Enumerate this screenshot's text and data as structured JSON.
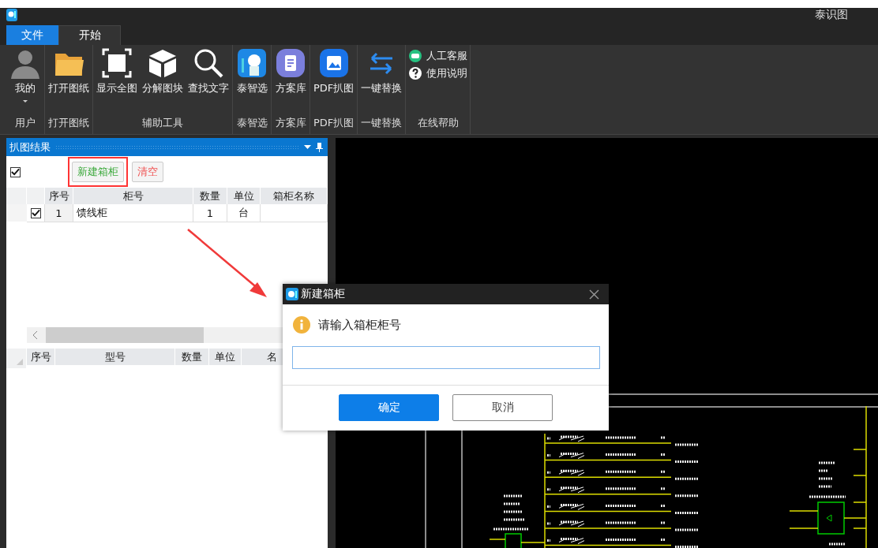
{
  "window": {
    "title": "泰识图"
  },
  "tabs": [
    {
      "label": "文件",
      "kind": "file",
      "selected": false
    },
    {
      "label": "开始",
      "kind": "tab",
      "selected": true
    }
  ],
  "ribbon": {
    "groups": [
      {
        "label": "用户",
        "buttons": [
          {
            "label": "我的",
            "kind": "large",
            "dropdown": true
          }
        ]
      },
      {
        "label": "打开图纸",
        "buttons": [
          {
            "label": "打开图纸",
            "kind": "large",
            "dropdown": false
          }
        ]
      },
      {
        "label": "辅助工具",
        "buttons": [
          {
            "label": "显示全图",
            "kind": "large",
            "dropdown": false
          },
          {
            "label": "分解图块",
            "kind": "large",
            "dropdown": false
          },
          {
            "label": "查找文字",
            "kind": "large",
            "dropdown": false
          }
        ]
      },
      {
        "label": "泰智选",
        "buttons": [
          {
            "label": "泰智选",
            "kind": "large",
            "dropdown": false
          }
        ]
      },
      {
        "label": "方案库",
        "buttons": [
          {
            "label": "方案库",
            "kind": "large",
            "dropdown": false
          }
        ]
      },
      {
        "label": "PDF扒图",
        "buttons": [
          {
            "label": "PDF扒图",
            "kind": "large",
            "dropdown": false
          }
        ]
      },
      {
        "label": "一键替换",
        "buttons": [
          {
            "label": "一键替换",
            "kind": "large",
            "dropdown": false
          }
        ]
      },
      {
        "label": "在线帮助",
        "buttons": [
          {
            "label": "人工客服",
            "kind": "small",
            "dropdown": false
          },
          {
            "label": "使用说明",
            "kind": "small",
            "dropdown": false
          }
        ]
      }
    ]
  },
  "panel": {
    "title": "扒图结果",
    "select_all": {
      "checked": true
    },
    "buttons": [
      {
        "label": "新建箱柜",
        "kind": "new",
        "highlighted": true
      },
      {
        "label": "清空",
        "kind": "clear",
        "highlighted": false
      }
    ],
    "cabinet_table": {
      "columns": [
        "序号",
        "柜号",
        "数量",
        "单位",
        "箱柜名称"
      ],
      "rows": [
        {
          "checked": true,
          "cells": [
            "1",
            "馈线柜",
            "1",
            "台",
            ""
          ]
        }
      ]
    },
    "part_table": {
      "columns": [
        "序号",
        "型号",
        "数量",
        "单位",
        "名"
      ]
    }
  },
  "dialog": {
    "title": "新建箱柜",
    "message": "请输入箱柜柜号",
    "input": {
      "focused": true
    },
    "buttons": [
      {
        "label": "确定",
        "primary": true
      },
      {
        "label": "取消",
        "primary": false
      }
    ]
  }
}
